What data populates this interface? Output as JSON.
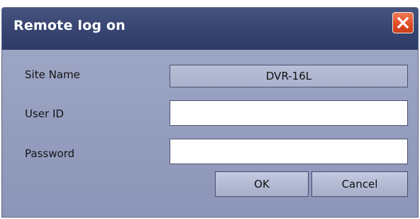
{
  "background": {
    "partial_text": "...logon..."
  },
  "dialog": {
    "title": "Remote log on",
    "close_icon": "close-x-icon",
    "fields": {
      "site_name": {
        "label": "Site Name",
        "value": "DVR-16L"
      },
      "user_id": {
        "label": "User ID",
        "value": ""
      },
      "password": {
        "label": "Password",
        "value": ""
      }
    },
    "buttons": {
      "ok_label": "OK",
      "cancel_label": "Cancel"
    }
  },
  "colors": {
    "titlebar": "#394673",
    "body": "#939bbd",
    "close_button": "#de4a22"
  }
}
